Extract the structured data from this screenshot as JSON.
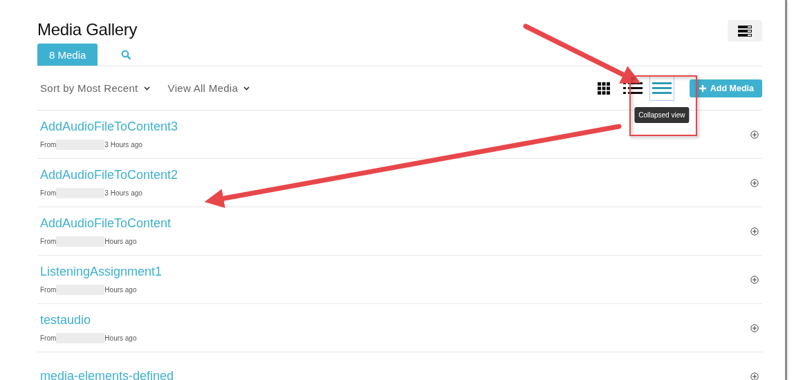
{
  "header": {
    "title": "Media Gallery"
  },
  "tabs": [
    {
      "kind": "label",
      "label": "8 Media",
      "selected": true
    },
    {
      "kind": "search",
      "selected": false
    }
  ],
  "toolbar": {
    "sort": "Sort by Most Recent",
    "filter": "View All Media",
    "view_modes": [
      {
        "kind": "grid",
        "selected": false
      },
      {
        "kind": "list",
        "selected": false
      },
      {
        "kind": "collapsed",
        "selected": true
      }
    ],
    "tooltip": "Collapsed view",
    "add_button": "Add Media"
  },
  "items": [
    {
      "title": "AddAudioFileToContent3",
      "from": "From",
      "time": "3 Hours ago"
    },
    {
      "title": "AddAudioFileToContent2",
      "from": "From",
      "time": "3 Hours ago"
    },
    {
      "title": "AddAudioFileToContent",
      "from": "From",
      "time": "Hours ago"
    },
    {
      "title": "ListeningAssignment1",
      "from": "From",
      "time": "Hours ago"
    },
    {
      "title": "testaudio",
      "from": "From",
      "time": "Hours ago"
    },
    {
      "title": "media-elements-defined"
    }
  ]
}
